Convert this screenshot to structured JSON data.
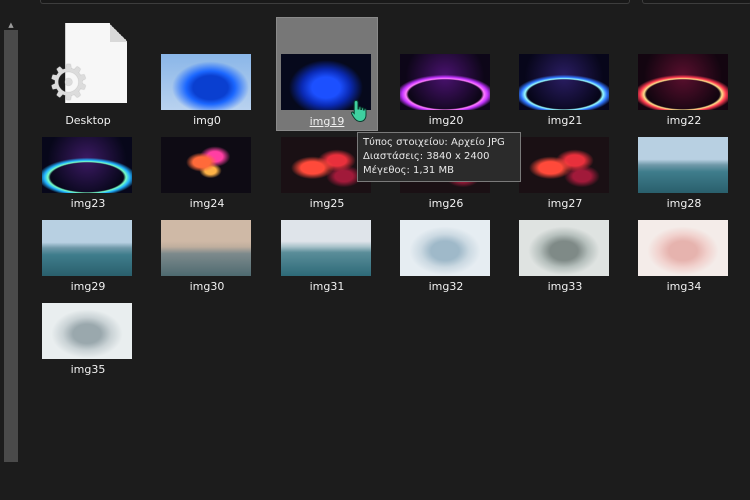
{
  "items": [
    {
      "label": "Desktop",
      "type": "desktop"
    },
    {
      "label": "img0",
      "art": "t-bloom-light"
    },
    {
      "label": "img19",
      "art": "t-bloom-dark",
      "selected": true
    },
    {
      "label": "img20",
      "art": "t-glow-purple"
    },
    {
      "label": "img21",
      "art": "t-glow-blue"
    },
    {
      "label": "img22",
      "art": "t-glow-red"
    },
    {
      "label": "img23",
      "art": "t-glow-green"
    },
    {
      "label": "img24",
      "art": "t-flower-dark"
    },
    {
      "label": "img25",
      "art": "t-ribbon-dark"
    },
    {
      "label": "img26",
      "art": "t-ribbon-dark"
    },
    {
      "label": "img27",
      "art": "t-ribbon-dark"
    },
    {
      "label": "img28",
      "art": "t-sea-blue"
    },
    {
      "label": "img29",
      "art": "t-sea-blue"
    },
    {
      "label": "img30",
      "art": "t-sea-dusk"
    },
    {
      "label": "img31",
      "art": "t-sea-sunrise"
    },
    {
      "label": "img32",
      "art": "t-bloom-ice"
    },
    {
      "label": "img33",
      "art": "t-bloom-grey"
    },
    {
      "label": "img34",
      "art": "t-bloom-pink"
    },
    {
      "label": "img35",
      "art": "t-bloom-silver"
    }
  ],
  "tooltip": {
    "type_line": "Τύπος στοιχείου: Αρχείο JPG",
    "dimensions_line": "Διαστάσεις: 3840 x 2400",
    "size_line": "Μέγεθος: 1,31 MB"
  },
  "icons": {
    "gear": "gear-icon",
    "cursor": "hand-pointer-icon",
    "scroll_up": "arrow-up-icon"
  },
  "colors": {
    "background": "#1c1c1c",
    "selection": "#777777",
    "cursor": "#3fd0a0"
  }
}
